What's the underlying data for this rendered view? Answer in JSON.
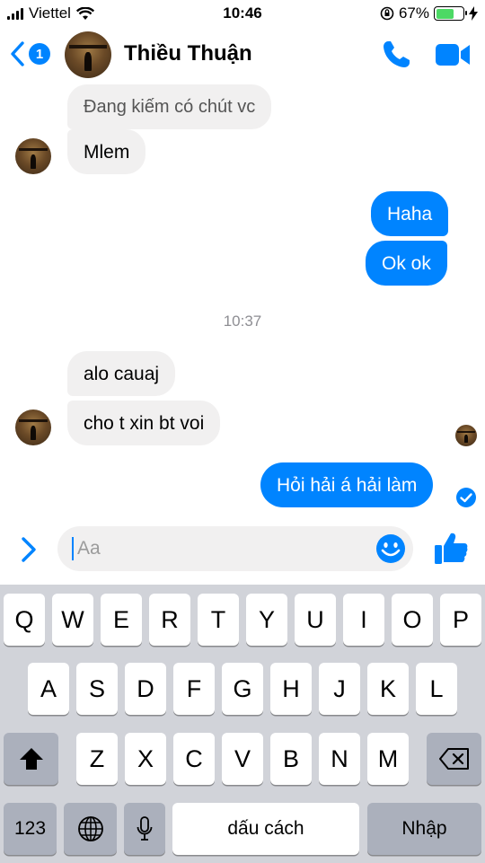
{
  "status_bar": {
    "carrier": "Viettel",
    "time": "10:46",
    "battery_percent": "67%",
    "battery_level": 0.67
  },
  "header": {
    "back_badge_count": "1",
    "contact_name": "Thiều Thuận"
  },
  "messages": {
    "incoming_1": "Đang kiếm có chút vc",
    "incoming_2": "Mlem",
    "outgoing_1": "Haha",
    "outgoing_2": "Ok ok",
    "timestamp": "10:37",
    "incoming_3": "alo cauaj",
    "incoming_4": "cho t xin bt voi",
    "outgoing_3": "Hỏi hải á hải làm"
  },
  "composer": {
    "placeholder": "Aa"
  },
  "keyboard": {
    "row1": [
      "Q",
      "W",
      "E",
      "R",
      "T",
      "Y",
      "U",
      "I",
      "O",
      "P"
    ],
    "row2": [
      "A",
      "S",
      "D",
      "F",
      "G",
      "H",
      "J",
      "K",
      "L"
    ],
    "row3": [
      "Z",
      "X",
      "C",
      "V",
      "B",
      "N",
      "M"
    ],
    "numbers_key": "123",
    "space_key": "dấu cách",
    "return_key": "Nhập"
  },
  "colors": {
    "accent": "#0084ff",
    "incoming_bubble": "#f1f0f0",
    "keyboard_bg": "#d1d3d9",
    "battery_fill": "#4cd964"
  },
  "icons": {
    "back": "chevron-left-icon",
    "call": "phone-icon",
    "video": "video-camera-icon",
    "composer_toggle": "chevron-right-icon",
    "emoji": "smiley-icon",
    "like": "thumbs-up-icon",
    "seen": "check-circle-icon",
    "shift": "shift-arrow-icon",
    "delete": "backspace-icon",
    "globe": "globe-icon",
    "mic": "microphone-icon"
  }
}
